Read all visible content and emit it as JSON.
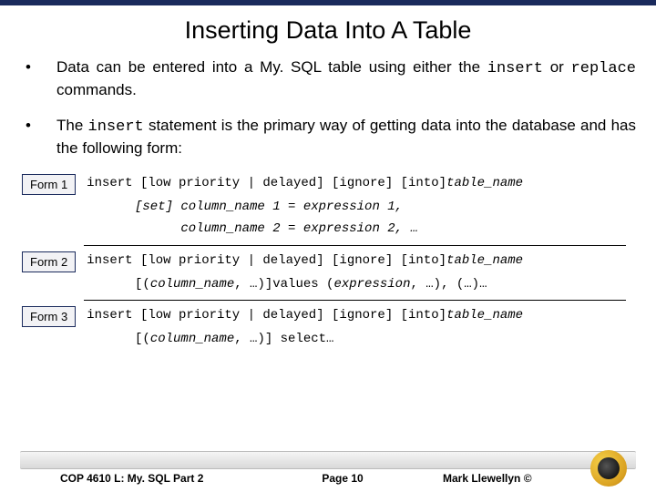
{
  "title": "Inserting Data Into A Table",
  "bullets": [
    {
      "pre": "Data can be entered into a My. SQL table using either the ",
      "code1": "insert",
      "mid": " or ",
      "code2": "replace",
      "post": " commands."
    },
    {
      "pre": "The ",
      "code1": "insert",
      "mid": " statement is the primary way of getting data into the database and has the following form:",
      "code2": "",
      "post": ""
    }
  ],
  "forms": [
    {
      "label": "Form 1",
      "l1a": "insert [low priority | delayed] [ignore] [into]",
      "l1b": "table_name",
      "l2": "[set] column_name 1 = expression 1,",
      "l3": "      column_name 2 = expression 2, …"
    },
    {
      "label": "Form 2",
      "l1a": "insert [low priority | delayed] [ignore] [into]",
      "l1b": "table_name",
      "l2a": "[(",
      "l2b": "column_name",
      "l2c": ", …)]values (",
      "l2d": "expression",
      "l2e": ", …), (…)…"
    },
    {
      "label": "Form 3",
      "l1a": "insert [low priority | delayed] [ignore] [into]",
      "l1b": "table_name",
      "l2a": "[(",
      "l2b": "column_name",
      "l2c": ", …)] select…"
    }
  ],
  "footer": {
    "left": "COP 4610 L: My. SQL Part 2",
    "center": "Page 10",
    "right": "Mark Llewellyn ©"
  }
}
